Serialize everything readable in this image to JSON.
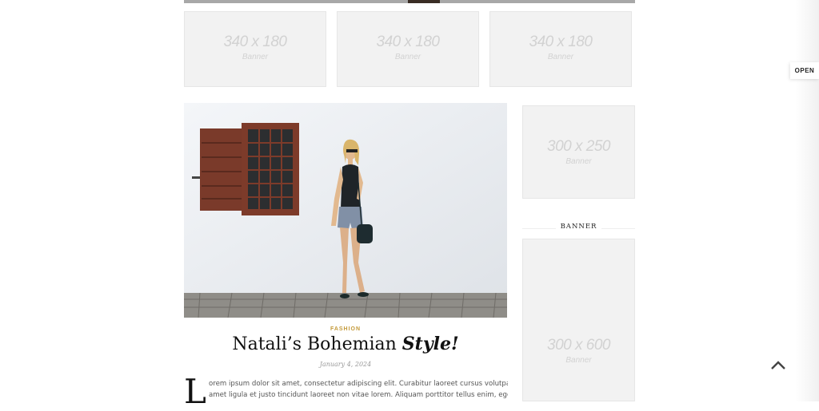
{
  "top_banners": [
    {
      "size": "340 x 180",
      "label": "Banner"
    },
    {
      "size": "340 x 180",
      "label": "Banner"
    },
    {
      "size": "340 x 180",
      "label": "Banner"
    }
  ],
  "post": {
    "category": "FASHION",
    "title_plain": "Natali’s Bohemian ",
    "title_emphasis": "Style!",
    "date": "January 4, 2024",
    "dropcap": "L",
    "excerpt_lines": [
      "orem ipsum dolor sit amet, consectetur adipiscing elit. Curabitur laoreet cursus volutpat. Aliquam sit",
      "amet ligula et justo tincidunt laoreet non vitae lorem. Aliquam porttitor tellus enim, eget commodo"
    ]
  },
  "sidebar": {
    "banner_small": {
      "size": "300 x 250",
      "label": "Banner"
    },
    "widget_title": "BANNER",
    "banner_tall": {
      "size": "300 x 600",
      "label": "Banner"
    }
  },
  "open_tab_label": "OPEN",
  "icons": {
    "back_to_top": "chevron-up-icon"
  },
  "colors": {
    "category": "#c49a3a",
    "placeholder_bg": "#f2f2f2",
    "placeholder_text": "#d2d2d2"
  }
}
